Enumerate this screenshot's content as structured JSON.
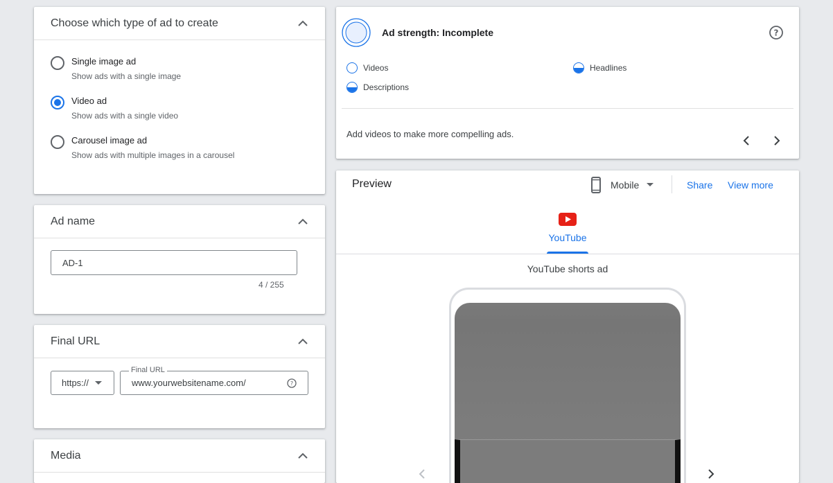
{
  "ad_type": {
    "title": "Choose which type of ad to create",
    "options": [
      {
        "label": "Single image ad",
        "description": "Show ads with a single image",
        "selected": false
      },
      {
        "label": "Video ad",
        "description": "Show ads with a single video",
        "selected": true
      },
      {
        "label": "Carousel image ad",
        "description": "Show ads with multiple images in a carousel",
        "selected": false
      }
    ]
  },
  "ad_name": {
    "title": "Ad name",
    "value": "AD-1",
    "counter": "4 / 255"
  },
  "final_url": {
    "title": "Final URL",
    "protocol": "https://",
    "field_label": "Final URL",
    "value": "www.yourwebsitename.com/"
  },
  "media": {
    "title": "Media"
  },
  "ad_strength": {
    "title": "Ad strength: Incomplete",
    "items": [
      {
        "label": "Videos",
        "state": "empty"
      },
      {
        "label": "Headlines",
        "state": "half"
      },
      {
        "label": "Descriptions",
        "state": "half"
      }
    ],
    "tip": "Add videos to make more compelling ads."
  },
  "preview": {
    "title": "Preview",
    "device": "Mobile",
    "share_label": "Share",
    "view_more_label": "View more",
    "tab_label": "YouTube",
    "ad_format_label": "YouTube shorts ad"
  },
  "colors": {
    "accent": "#1a73e8",
    "youtube_red": "#e62117",
    "background": "#e8eaed"
  }
}
